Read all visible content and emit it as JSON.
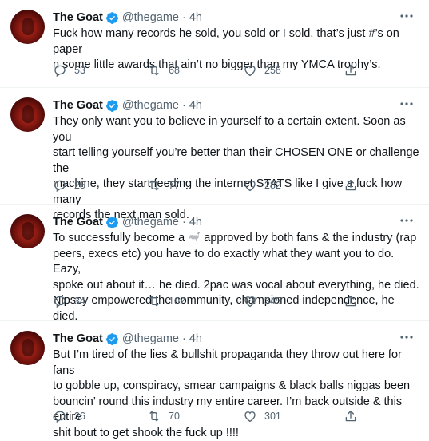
{
  "tweets": [
    {
      "name": "The Goat",
      "handle": "@thegame",
      "dot": "·",
      "time": "4h",
      "lines": [
        "Fuck how many records he sold, you sold or I sold. that’s just #’s on paper",
        "n some little awards that ain’t no bigger than my YMCA trophy’s."
      ],
      "replies": "53",
      "retweets": "68",
      "likes": "258"
    },
    {
      "name": "The Goat",
      "handle": "@thegame",
      "dot": "·",
      "time": "4h",
      "lines": [
        "They only want you to believe in yourself to a certain extent. Soon as you",
        "start telling yourself you’re better than their CHOSEN ONE or challenge the",
        "machine, they start feeding the internet STATS like I give a fuck how many",
        "records the next man sold."
      ],
      "replies": "25",
      "retweets": "77",
      "likes": "282"
    },
    {
      "name": "The Goat",
      "handle": "@thegame",
      "dot": "·",
      "time": "4h",
      "line1_before": "To successfully become a",
      "line1_after": "approved by both fans & the industry (rap",
      "lines": [
        "peers, execs etc) you have to do exactly what they want you to do. Eazy,",
        "spoke out about it… he died. 2pac was vocal about everything, he died.",
        "Nipsey empowered the community, championed independence, he died."
      ],
      "replies": "34",
      "retweets": "102",
      "likes": "345"
    },
    {
      "name": "The Goat",
      "handle": "@thegame",
      "dot": "·",
      "time": "4h",
      "lines": [
        "But I’m tired of the lies & bullshit propaganda they throw out here for fans",
        "to gobble up, conspiracy, smear campaigns & black balls niggas been",
        "bouncin’ round this industry my entire career. I’m back outside & this entire",
        "shit bout to get shook the fuck up !!!!"
      ],
      "replies": "36",
      "retweets": "70",
      "likes": "301"
    }
  ],
  "icons": {
    "verified": "verified-badge-icon",
    "more": "more-horizontal-icon",
    "reply": "reply-icon",
    "retweet": "retweet-icon",
    "like": "heart-icon",
    "share": "share-icon",
    "goat": "goat-emoji"
  },
  "colors": {
    "verified": "#1d9bf0",
    "muted": "#536471",
    "text": "#0f1419",
    "divider": "#eff3f4"
  }
}
